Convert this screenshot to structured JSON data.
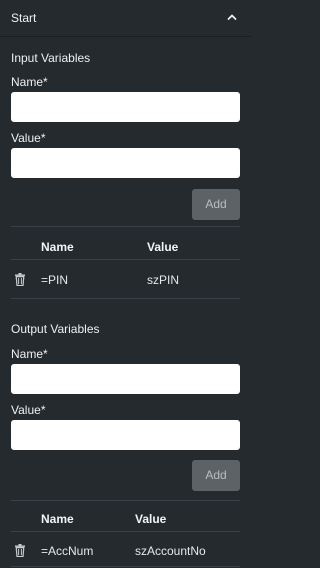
{
  "header": {
    "title": "Start",
    "chevron_icon": "chevron-up-icon"
  },
  "input_section": {
    "title": "Input Variables",
    "name_label": "Name",
    "value_label": "Value",
    "required_mark": "*",
    "name_value": "",
    "value_value": "",
    "add_label": "Add",
    "columns": [
      "Name",
      "Value"
    ],
    "rows": [
      {
        "name": "=PIN",
        "value": "szPIN",
        "delete_icon": "trash-icon"
      }
    ]
  },
  "output_section": {
    "title": "Output Variables",
    "name_label": "Name",
    "value_label": "Value",
    "required_mark": "*",
    "name_value": "",
    "value_value": "",
    "add_label": "Add",
    "columns": [
      "Name",
      "Value"
    ],
    "rows": [
      {
        "name": "=AccNum",
        "value": "szAccountNo",
        "delete_icon": "trash-icon"
      }
    ]
  },
  "colors": {
    "panel_bg": "#252a2e",
    "input_bg": "#ffffff",
    "disabled_button_bg": "#5d6266",
    "divider": "#3a4045"
  }
}
